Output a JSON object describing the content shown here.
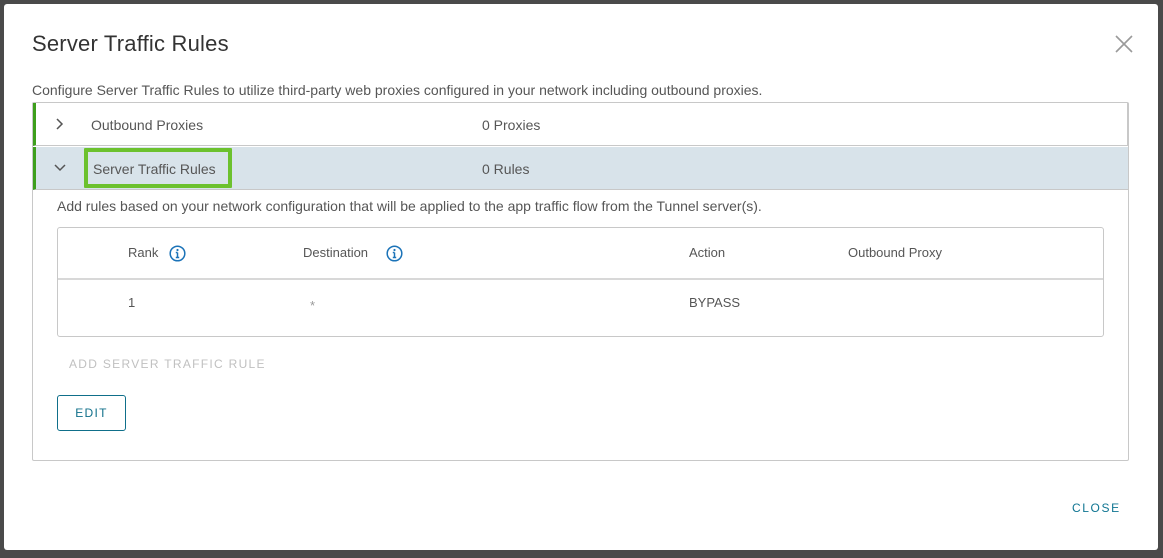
{
  "dialog": {
    "title": "Server Traffic Rules",
    "description": "Configure Server Traffic Rules to utilize third-party web proxies configured in your network including outbound proxies."
  },
  "sections": [
    {
      "label": "Outbound Proxies",
      "count": "0 Proxies",
      "expanded": false
    },
    {
      "label": "Server Traffic Rules",
      "count": "0 Rules",
      "expanded": true
    }
  ],
  "rules": {
    "description": "Add rules based on your network configuration that will be applied to the app traffic flow from the Tunnel server(s).",
    "columns": [
      "Rank",
      "Destination",
      "Action",
      "Outbound Proxy"
    ],
    "rows": [
      {
        "rank": "1",
        "destination": "*",
        "action": "BYPASS",
        "outbound_proxy": ""
      }
    ],
    "add_label": "ADD SERVER TRAFFIC RULE",
    "edit_label": "EDIT"
  },
  "footer": {
    "close_label": "CLOSE"
  },
  "colors": {
    "accent": "#0f6f8a",
    "section_bar": "#3d9f1c",
    "highlight": "#6cc12e",
    "info_icon": "#1b73b8"
  }
}
